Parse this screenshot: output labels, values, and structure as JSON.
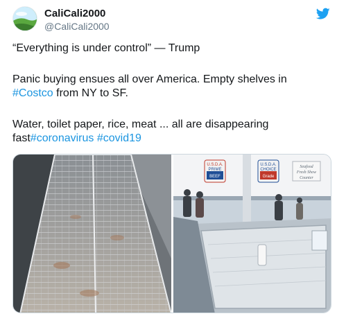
{
  "user": {
    "display_name": "CaliCali2000",
    "handle": "@CaliCali2000",
    "avatar_icon": "landscape-avatar-icon"
  },
  "brand": {
    "icon": "twitter-bird-icon",
    "color": "#1da1f2"
  },
  "tweet": {
    "line1": "“Everything is under control” — Trump",
    "p2_before": "Panic buying ensues all over America. Empty shelves in ",
    "p2_tag": "#Costco",
    "p2_after": " from NY to SF.",
    "p3_before": "Water, toilet paper, rice, meat ... all are disappearing fast",
    "p3_tag1": "#coronavirus",
    "p3_space": " ",
    "p3_tag2": "#covid19",
    "hashtag_color": "#1b95e0"
  },
  "media": {
    "left_image": "empty wire shelving",
    "right_image": "empty store freezers",
    "signs": [
      {
        "line1": "U.S.D.A.",
        "line2": "PRIME",
        "line3": "BEEF"
      },
      {
        "line1": "U.S.D.A.",
        "line2": "CHOICE",
        "line3": "Grade"
      },
      {
        "line1": "Seafood",
        "line2": "Fresh Show",
        "line3": "Counter"
      }
    ]
  }
}
